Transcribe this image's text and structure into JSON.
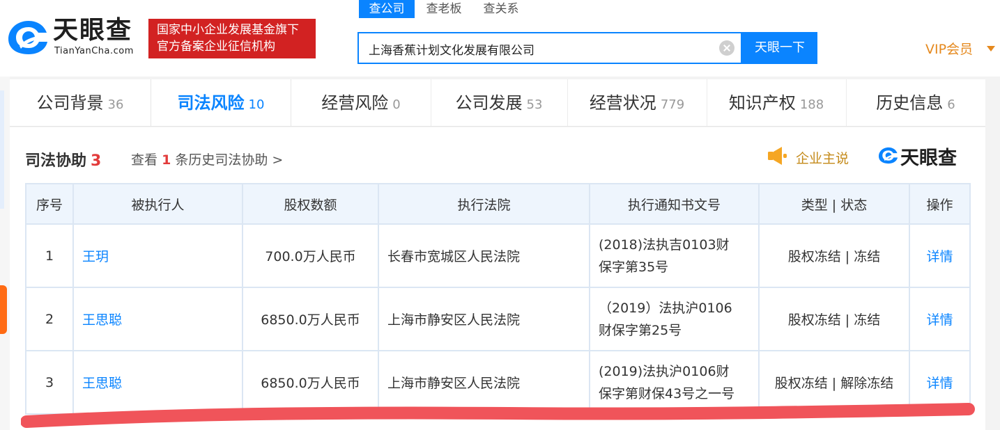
{
  "header": {
    "logo_text": "天眼查",
    "logo_domain": "TianYanCha.com",
    "badge_lines": [
      "国家中小企业发展基金旗下",
      "官方备案企业征信机构"
    ],
    "search_tabs": [
      "查公司",
      "查老板",
      "查关系"
    ],
    "search_value": "上海香蕉计划文化发展有限公司",
    "search_button": "天眼一下",
    "vip_label": "VIP会员"
  },
  "nav": {
    "tabs": [
      {
        "label": "公司背景",
        "count": "36"
      },
      {
        "label": "司法风险",
        "count": "10"
      },
      {
        "label": "经营风险",
        "count": "0"
      },
      {
        "label": "公司发展",
        "count": "53"
      },
      {
        "label": "经营状况",
        "count": "779"
      },
      {
        "label": "知识产权",
        "count": "188"
      },
      {
        "label": "历史信息",
        "count": "6"
      }
    ]
  },
  "section": {
    "title": "司法协助",
    "count": "3",
    "history_prefix": "查看",
    "history_count": "1",
    "history_suffix": "条历史司法协助 >",
    "company_says": "企业主说",
    "brand": "天眼查"
  },
  "table": {
    "headers": [
      "序号",
      "被执行人",
      "股权数额",
      "执行法院",
      "执行通知书文号",
      "类型 | 状态",
      "操作"
    ],
    "rows": [
      {
        "no": "1",
        "person": "王玥",
        "amount": "700.0万人民币",
        "court": "长春市宽城区人民法院",
        "doc": [
          "(2018)法执吉0103财",
          "保字第35号"
        ],
        "status": "股权冻结 | 冻结",
        "action": "详情"
      },
      {
        "no": "2",
        "person": "王思聪",
        "amount": "6850.0万人民币",
        "court": "上海市静安区人民法院",
        "doc": [
          "（2019）法执沪0106",
          "财保字第25号"
        ],
        "status": "股权冻结 | 冻结",
        "action": "详情"
      },
      {
        "no": "3",
        "person": "王思聪",
        "amount": "6850.0万人民币",
        "court": "上海市静安区人民法院",
        "doc": [
          "(2019)法执沪0106财",
          "保字第财保43号之一号"
        ],
        "status": "股权冻结 | 解除冻结",
        "action": "详情"
      }
    ]
  },
  "colors": {
    "accent": "#0a84ff",
    "badge_red": "#d22222",
    "vip_orange": "#e5891e",
    "count_red": "#e23b3b",
    "annotation_red": "#f0545a"
  }
}
